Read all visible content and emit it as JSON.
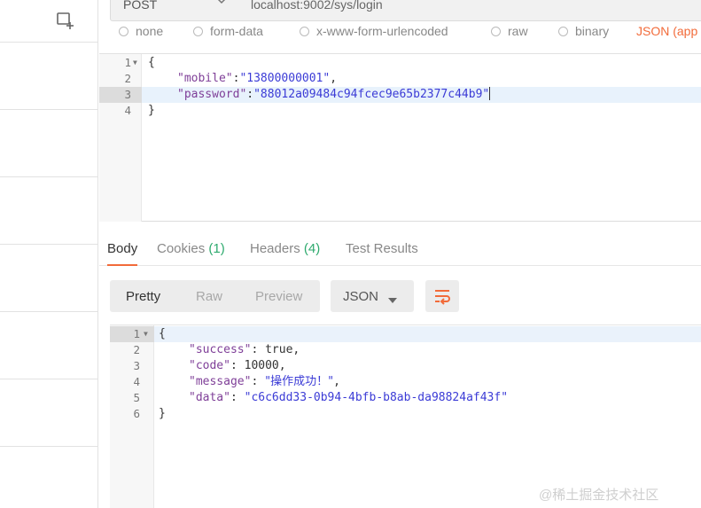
{
  "request": {
    "method": "POST",
    "url": "localhost:9002/sys/login",
    "body_types": [
      "none",
      "form-data",
      "x-www-form-urlencoded",
      "raw",
      "binary",
      "JSON (app"
    ],
    "body_lines": [
      {
        "num": "1",
        "text": "{"
      },
      {
        "num": "2",
        "key": "\"mobile\"",
        "sep": ":",
        "value": "\"13800000001\"",
        "tail": ","
      },
      {
        "num": "3",
        "key": "\"password\"",
        "sep": ":",
        "value": "\"88012a09484c94fcec9e65b2377c44b9\"",
        "tail": ""
      },
      {
        "num": "4",
        "text": "}"
      }
    ]
  },
  "response": {
    "tabs": {
      "body": "Body",
      "cookies": "Cookies",
      "cookies_count": "(1)",
      "headers": "Headers",
      "headers_count": "(4)",
      "test_results": "Test Results"
    },
    "views": {
      "pretty": "Pretty",
      "raw": "Raw",
      "preview": "Preview"
    },
    "format": "JSON",
    "body_lines": [
      {
        "num": "1",
        "text": "{"
      },
      {
        "num": "2",
        "key": "\"success\"",
        "sep": ": ",
        "value": "true",
        "tail": ","
      },
      {
        "num": "3",
        "key": "\"code\"",
        "sep": ": ",
        "value": "10000",
        "tail": ","
      },
      {
        "num": "4",
        "key": "\"message\"",
        "sep": ": ",
        "value": "\"操作成功！\"",
        "tail": ","
      },
      {
        "num": "5",
        "key": "\"data\"",
        "sep": ": ",
        "value": "\"c6c6dd33-0b94-4bfb-b8ab-da98824af43f\"",
        "tail": ""
      },
      {
        "num": "6",
        "text": "}"
      }
    ]
  },
  "watermark": "@稀土掘金技术社区",
  "colors": {
    "accent": "#f26b3a",
    "count_green": "#2eaa6e",
    "json_key": "#7f3f98",
    "json_string": "#3b3bd6",
    "active_line": "#e8f2fc"
  },
  "icons": {
    "new_tab": "new-tab-icon",
    "method_caret": "chevron-down-icon",
    "format_caret": "caret-down-icon",
    "wrap": "wrap-lines-icon",
    "fold": "fold-arrow-icon"
  }
}
